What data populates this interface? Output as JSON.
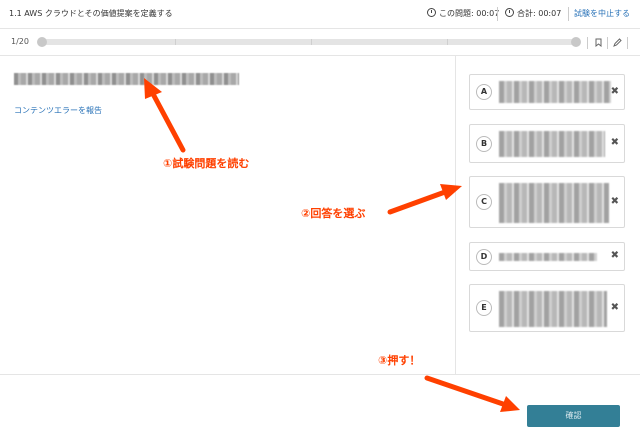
{
  "header": {
    "title": "1.1 AWS クラウドとその価値提案を定義する",
    "question_timer": "この問題: 00:07",
    "total_timer": "合計: 00:07",
    "stop_exam": "試験を中止する"
  },
  "progress": {
    "count": "1/20",
    "fraction": 0.05
  },
  "main": {
    "report_link": "コンテンツエラーを報告"
  },
  "answers": [
    {
      "letter": "A",
      "remove": "✖"
    },
    {
      "letter": "B",
      "remove": "✖"
    },
    {
      "letter": "C",
      "remove": "✖"
    },
    {
      "letter": "D",
      "remove": "✖"
    },
    {
      "letter": "E",
      "remove": "✖"
    }
  ],
  "footer": {
    "confirm_label": "確認"
  },
  "annotations": {
    "step1": "①試験問題を読む",
    "step2": "②回答を選ぶ",
    "step3": "③押す！"
  },
  "colors": {
    "accent": "#337f96",
    "link": "#2a73b8",
    "annotation": "#ff4000"
  },
  "icons": {
    "timer": "stopwatch-icon",
    "bookmark": "bookmark-icon",
    "edit": "pencil-icon",
    "remove": "cross-icon"
  }
}
